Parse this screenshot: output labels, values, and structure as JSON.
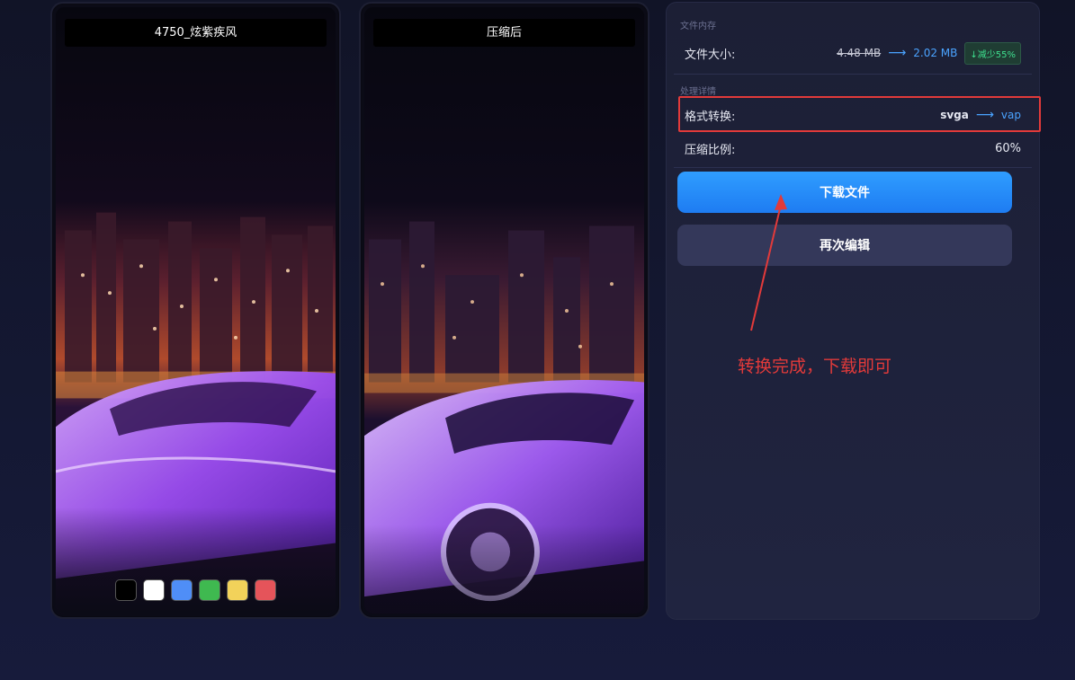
{
  "left_preview": {
    "title": "4750_炫紫疾风",
    "swatches": [
      "#000000",
      "#ffffff",
      "#4f8ef7",
      "#3fb950",
      "#f2d25a",
      "#e5545a"
    ]
  },
  "right_preview": {
    "title": "压缩后"
  },
  "panel": {
    "file_memory_label": "文件内存",
    "file_size": {
      "label": "文件大小:",
      "original": "4.48 MB",
      "arrow": "⟶",
      "compressed": "2.02 MB",
      "reduction_badge": "↓减少55%"
    },
    "details_label": "处理详情",
    "format": {
      "label": "格式转换:",
      "from": "svga",
      "arrow": "⟶",
      "to": "vap"
    },
    "ratio": {
      "label": "压缩比例:",
      "value": "60%"
    },
    "download_button": "下载文件",
    "reedit_button": "再次编辑"
  },
  "annotation": {
    "text": "转换完成，下载即可",
    "color": "#e23a3a"
  },
  "colors": {
    "accent": "#1e8bff",
    "success": "#3ee08f",
    "highlight": "#e23a3a"
  }
}
